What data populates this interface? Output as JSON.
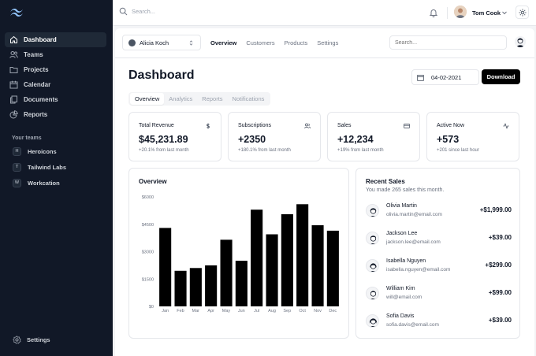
{
  "sidebar": {
    "logo_icon": "tailwind-logo-icon",
    "items": [
      {
        "label": "Dashboard",
        "icon": "home-icon",
        "active": true
      },
      {
        "label": "Teams",
        "icon": "users-icon"
      },
      {
        "label": "Projects",
        "icon": "folder-icon"
      },
      {
        "label": "Calendar",
        "icon": "calendar-icon"
      },
      {
        "label": "Documents",
        "icon": "documents-icon"
      },
      {
        "label": "Reports",
        "icon": "pie-chart-icon"
      }
    ],
    "teams_label": "Your teams",
    "teams": [
      {
        "badge": "H",
        "label": "Heroicons"
      },
      {
        "badge": "T",
        "label": "Tailwind Labs"
      },
      {
        "badge": "W",
        "label": "Workcation"
      }
    ],
    "settings_label": "Settings"
  },
  "topbar": {
    "search_placeholder": "Search...",
    "user_name": "Tom Cook"
  },
  "main": {
    "switcher_label": "Alicia Koch",
    "subnav": [
      "Overview",
      "Customers",
      "Products",
      "Settings"
    ],
    "search_placeholder": "Search...",
    "title": "Dashboard",
    "date": "04-02-2021",
    "download_label": "Download",
    "tabs": [
      "Overview",
      "Analytics",
      "Reports",
      "Notifications"
    ]
  },
  "kpis": [
    {
      "title": "Total Revenue",
      "icon": "dollar-icon",
      "value": "$45,231.89",
      "sub": "+20.1% from last month"
    },
    {
      "title": "Subscriptions",
      "icon": "users-icon",
      "value": "+2350",
      "sub": "+180.1% from last month"
    },
    {
      "title": "Sales",
      "icon": "credit-card-icon",
      "value": "+12,234",
      "sub": "+19% from last month"
    },
    {
      "title": "Active Now",
      "icon": "activity-icon",
      "value": "+573",
      "sub": "+201 since last hour"
    }
  ],
  "overview": {
    "title": "Overview"
  },
  "chart_data": {
    "type": "bar",
    "title": "Overview",
    "categories": [
      "Jan",
      "Feb",
      "Mar",
      "Apr",
      "May",
      "Jun",
      "Jul",
      "Aug",
      "Sep",
      "Oct",
      "Nov",
      "Dec"
    ],
    "values": [
      4300,
      1950,
      2100,
      2250,
      3650,
      2500,
      5300,
      3950,
      5050,
      5600,
      4450,
      4150
    ],
    "yticks": [
      "$0",
      "$1500",
      "$3000",
      "$4500",
      "$6000"
    ],
    "ylim": [
      0,
      6000
    ],
    "color": "#000000"
  },
  "recent_sales": {
    "title": "Recent Sales",
    "subtitle": "You made 265 sales this month.",
    "items": [
      {
        "name": "Olivia Martin",
        "email": "olivia.martin@email.com",
        "amount": "+$1,999.00"
      },
      {
        "name": "Jackson Lee",
        "email": "jackson.lee@email.com",
        "amount": "+$39.00"
      },
      {
        "name": "Isabella Nguyen",
        "email": "isabella.nguyen@email.com",
        "amount": "+$299.00"
      },
      {
        "name": "William Kim",
        "email": "will@email.com",
        "amount": "+$99.00"
      },
      {
        "name": "Sofia Davis",
        "email": "sofia.davis@email.com",
        "amount": "+$39.00"
      }
    ]
  }
}
